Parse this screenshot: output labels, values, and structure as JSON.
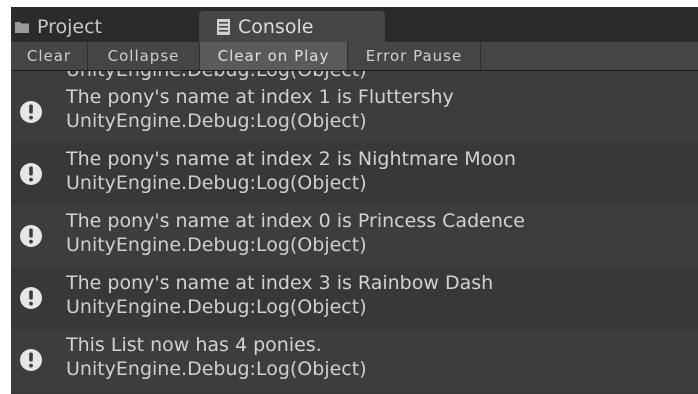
{
  "tabs": {
    "project": {
      "label": "Project",
      "icon": "folder-icon"
    },
    "console": {
      "label": "Console",
      "icon": "console-icon"
    }
  },
  "toolbar": {
    "clear": "Clear",
    "collapse": "Collapse",
    "clear_on_play": "Clear on Play",
    "error_pause": "Error Pause"
  },
  "log": {
    "cutoff_text": "UnityEngine.Debug:Log(Object)",
    "entries": [
      {
        "message": "The pony's name at index 1 is Fluttershy",
        "trace": "UnityEngine.Debug:Log(Object)",
        "icon": "info-icon"
      },
      {
        "message": "The pony's name at index 2 is Nightmare Moon",
        "trace": "UnityEngine.Debug:Log(Object)",
        "icon": "info-icon"
      },
      {
        "message": "The pony's name at index 0 is Princess Cadence",
        "trace": "UnityEngine.Debug:Log(Object)",
        "icon": "info-icon"
      },
      {
        "message": "The pony's name at index 3 is Rainbow Dash",
        "trace": "UnityEngine.Debug:Log(Object)",
        "icon": "info-icon"
      },
      {
        "message": "This List now has 4 ponies.",
        "trace": "UnityEngine.Debug:Log(Object)",
        "icon": "info-icon"
      }
    ]
  },
  "colors": {
    "background": "#3a3a3a",
    "tab_active": "#464646",
    "toolbar": "#454545",
    "toolbar_active": "#5a5a5a",
    "text": "#d2d2d2"
  }
}
